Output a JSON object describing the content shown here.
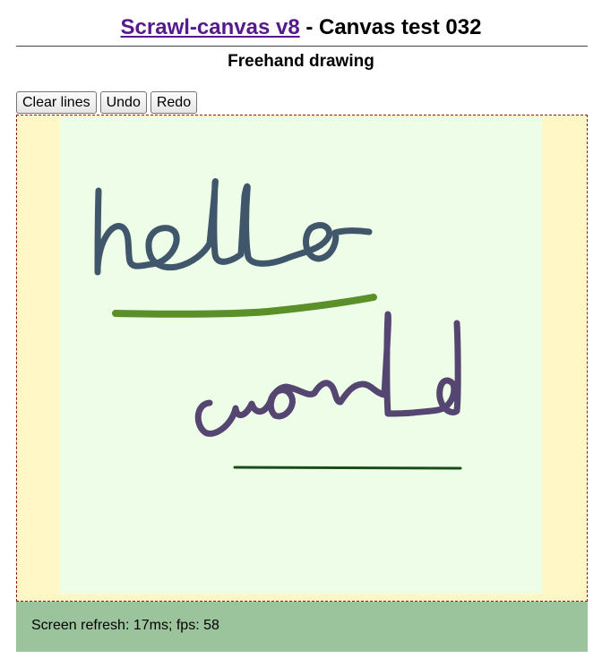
{
  "header": {
    "link_text": "Scrawl-canvas v8",
    "title_suffix": " - Canvas test 032",
    "subtitle": "Freehand drawing"
  },
  "toolbar": {
    "clear_label": "Clear lines",
    "undo_label": "Undo",
    "redo_label": "Redo"
  },
  "canvas": {
    "background_color": "#eefde8",
    "edge_color": "#fff8c6",
    "strokes": [
      {
        "name": "hello",
        "color": "#3f566b"
      },
      {
        "name": "green-underline",
        "color": "#5a8f29"
      },
      {
        "name": "world",
        "color": "#544571"
      },
      {
        "name": "dark-green-line",
        "color": "#184d17"
      }
    ]
  },
  "status": {
    "text": "Screen refresh: 17ms; fps: 58"
  }
}
